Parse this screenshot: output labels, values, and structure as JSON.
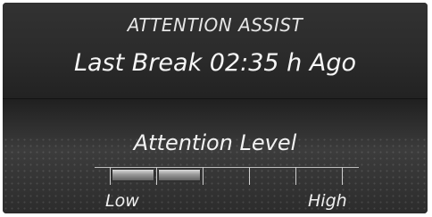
{
  "header": {
    "title": "ATTENTION ASSIST",
    "last_break": "Last Break 02:35 h Ago"
  },
  "level": {
    "label": "Attention Level",
    "low_label": "Low",
    "high_label": "High",
    "segments_total": 5,
    "segments_filled": 2
  },
  "colors": {
    "background": "#1a1a1a",
    "text": "#f2f2f2",
    "segment_fill": "#9a9a9a"
  }
}
